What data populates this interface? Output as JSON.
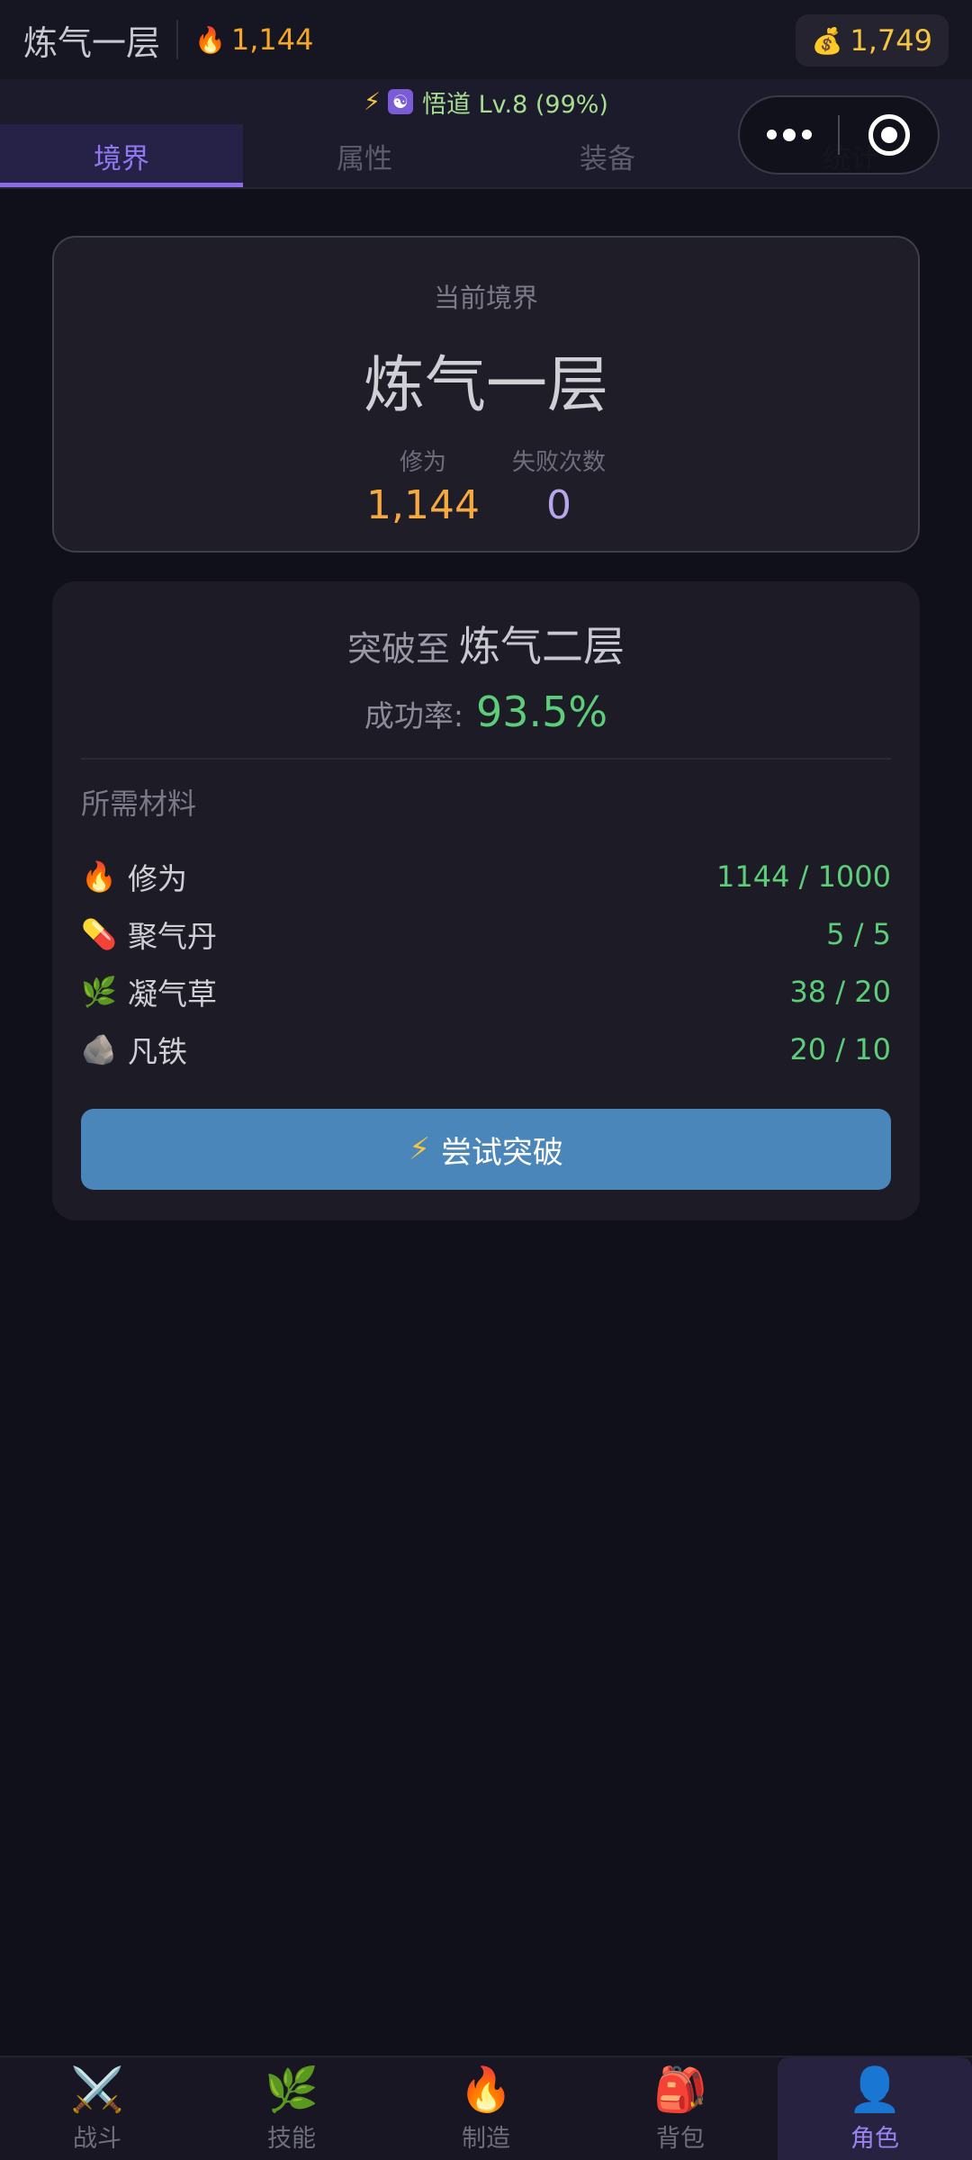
{
  "header": {
    "realm_title": "炼气一层",
    "cultivation_icon": "🔥",
    "cultivation_value": "1,144",
    "gold_icon": "💰",
    "gold_value": "1,749"
  },
  "status": {
    "bolt_icon": "⚡",
    "dao_icon": "☯",
    "text": "悟道 Lv.8 (99%)"
  },
  "tabs": [
    {
      "label": "境界",
      "active": true
    },
    {
      "label": "属性",
      "active": false
    },
    {
      "label": "装备",
      "active": false
    },
    {
      "label": "统计",
      "active": false
    }
  ],
  "realm_card": {
    "label": "当前境界",
    "name": "炼气一层",
    "stats": [
      {
        "label": "修为",
        "value": "1,144"
      },
      {
        "label": "失败次数",
        "value": "0"
      }
    ]
  },
  "breakthrough": {
    "prefix": "突破至",
    "target": "炼气二层",
    "rate_label": "成功率:",
    "rate_value": "93.5%",
    "materials_title": "所需材料",
    "materials": [
      {
        "icon": "🔥",
        "name": "修为",
        "qty": "1144 / 1000"
      },
      {
        "icon": "💊",
        "name": "聚气丹",
        "qty": "5 / 5"
      },
      {
        "icon": "🌿",
        "name": "凝气草",
        "qty": "38 / 20"
      },
      {
        "icon": "🪨",
        "name": "凡铁",
        "qty": "20 / 10"
      }
    ],
    "button_icon": "⚡",
    "button_label": "尝试突破"
  },
  "bottom_nav": [
    {
      "icon": "⚔️",
      "label": "战斗",
      "active": false
    },
    {
      "icon": "🌿",
      "label": "技能",
      "active": false
    },
    {
      "icon": "🔥",
      "label": "制造",
      "active": false
    },
    {
      "icon": "🎒",
      "label": "背包",
      "active": false
    },
    {
      "icon": "👤",
      "label": "角色",
      "active": true
    }
  ],
  "colors": {
    "background": "#10101b",
    "accent_purple": "#8a6be8",
    "success_green": "#5ccd78",
    "cultivation_orange": "#f5a940",
    "gold_yellow": "#f5c542",
    "button_blue": "#4a86b9"
  }
}
